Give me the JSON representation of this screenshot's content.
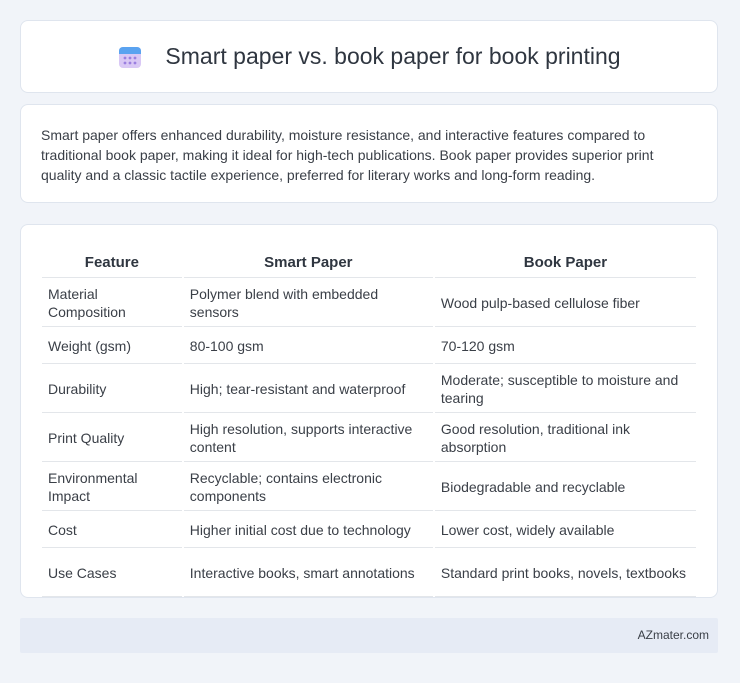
{
  "header": {
    "title": "Smart paper vs. book paper for book printing",
    "icon": "calendar-icon"
  },
  "summary": {
    "text": "Smart paper offers enhanced durability, moisture resistance, and interactive features compared to traditional book paper, making it ideal for high-tech publications. Book paper provides superior print quality and a classic tactile experience, preferred for literary works and long-form reading."
  },
  "table": {
    "headers": [
      "Feature",
      "Smart Paper",
      "Book Paper"
    ],
    "rows": [
      [
        "Material Composition",
        "Polymer blend with embedded sensors",
        "Wood pulp-based cellulose fiber"
      ],
      [
        "Weight (gsm)",
        "80-100 gsm",
        "70-120 gsm"
      ],
      [
        "Durability",
        "High; tear-resistant and waterproof",
        "Moderate; susceptible to moisture and tearing"
      ],
      [
        "Print Quality",
        "High resolution, supports interactive content",
        "Good resolution, traditional ink absorption"
      ],
      [
        "Environmental Impact",
        "Recyclable; contains electronic components",
        "Biodegradable and recyclable"
      ],
      [
        "Cost",
        "Higher initial cost due to technology",
        "Lower cost, widely available"
      ],
      [
        "Use Cases",
        "Interactive books, smart annotations",
        "Standard print books, novels, textbooks"
      ]
    ]
  },
  "footer": {
    "brand": "AZmater.com"
  }
}
